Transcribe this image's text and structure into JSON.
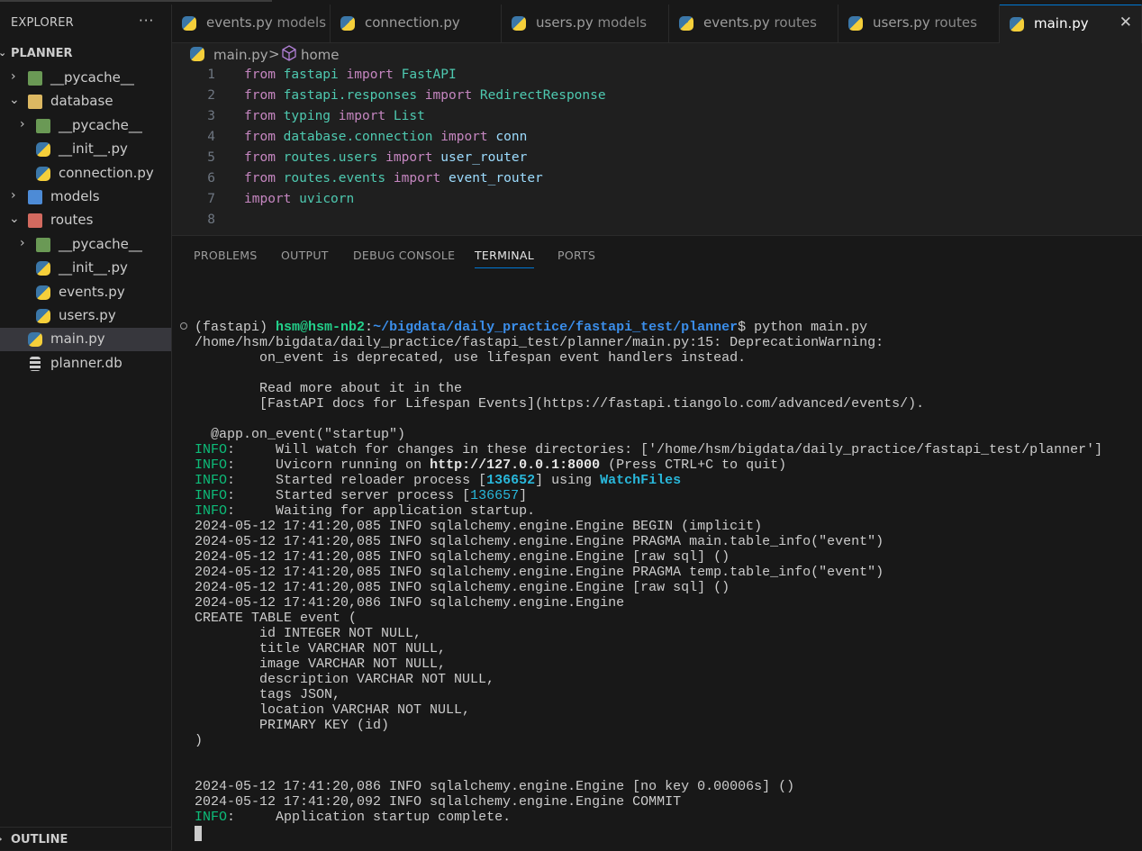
{
  "sidebar": {
    "title": "EXPLORER",
    "more": "···",
    "section": "PLANNER",
    "items": [
      {
        "label": "__pycache__",
        "icon": "pycache-folder-icon"
      },
      {
        "label": "database",
        "icon": "database-folder-icon"
      },
      {
        "label": "__pycache__",
        "icon": "pycache-folder-icon"
      },
      {
        "label": "__init__.py",
        "icon": "python-icon"
      },
      {
        "label": "connection.py",
        "icon": "python-icon"
      },
      {
        "label": "models",
        "icon": "models-folder-icon"
      },
      {
        "label": "routes",
        "icon": "routes-folder-icon"
      },
      {
        "label": "__pycache__",
        "icon": "pycache-folder-icon"
      },
      {
        "label": "__init__.py",
        "icon": "python-icon"
      },
      {
        "label": "events.py",
        "icon": "python-icon"
      },
      {
        "label": "users.py",
        "icon": "python-icon"
      },
      {
        "label": "main.py",
        "icon": "python-icon"
      },
      {
        "label": "planner.db",
        "icon": "database-icon"
      }
    ],
    "outline": "OUTLINE"
  },
  "tabs": [
    {
      "name": "events.py",
      "desc": "models"
    },
    {
      "name": "connection.py",
      "desc": ""
    },
    {
      "name": "users.py",
      "desc": "models"
    },
    {
      "name": "events.py",
      "desc": "routes"
    },
    {
      "name": "users.py",
      "desc": "routes"
    },
    {
      "name": "main.py",
      "desc": "",
      "active": true
    }
  ],
  "tab_close": "✕",
  "breadcrumb": {
    "file": "main.py",
    "sep": ">",
    "symbol": "home"
  },
  "editor": {
    "lines": [
      {
        "n": "1",
        "parts": [
          "from",
          "fastapi",
          "import",
          "FastAPI"
        ]
      },
      {
        "n": "2",
        "parts": [
          "from",
          "fastapi.responses",
          "import",
          "RedirectResponse"
        ]
      },
      {
        "n": "3",
        "parts": [
          "from",
          "typing",
          "import",
          "List"
        ]
      },
      {
        "n": "4",
        "parts": [
          "from",
          "database.connection",
          "import",
          "conn"
        ]
      },
      {
        "n": "5",
        "parts": [
          "from",
          "routes.users",
          "import",
          "user_router"
        ]
      },
      {
        "n": "6",
        "parts": [
          "from",
          "routes.events",
          "import",
          "event_router"
        ]
      },
      {
        "n": "7",
        "parts": [
          "import",
          "uvicorn",
          "",
          ""
        ]
      },
      {
        "n": "8",
        "parts": [
          "",
          "",
          "",
          ""
        ]
      }
    ]
  },
  "panel": {
    "tabs": [
      "PROBLEMS",
      "OUTPUT",
      "DEBUG CONSOLE",
      "TERMINAL",
      "PORTS"
    ],
    "active_tab": "TERMINAL"
  },
  "terminal": {
    "prompt_env": "(fastapi) ",
    "prompt_user": "hsm@hsm-nb2",
    "prompt_colon": ":",
    "prompt_path": "~/bigdata/daily_practice/fastapi_test/planner",
    "prompt_cmd": "$ python main.py",
    "lines": [
      "/home/hsm/bigdata/daily_practice/fastapi_test/planner/main.py:15: DeprecationWarning:",
      "        on_event is deprecated, use lifespan event handlers instead.",
      "",
      "        Read more about it in the",
      "        [FastAPI docs for Lifespan Events](https://fastapi.tiangolo.com/advanced/events/).",
      "",
      "  @app.on_event(\"startup\")"
    ],
    "info_label": "INFO",
    "info_colon": ":",
    "info1": "     Will watch for changes in these directories: ['/home/hsm/bigdata/daily_practice/fastapi_test/planner']",
    "info2_a": "     Uvicorn running on ",
    "info2_url": "http://127.0.0.1:8000",
    "info2_b": " (Press CTRL+C to quit)",
    "info3_a": "     Started reloader process [",
    "info3_pid": "136652",
    "info3_b": "] using ",
    "info3_tool": "WatchFiles",
    "info4_a": "     Started server process [",
    "info4_pid": "136657",
    "info4_b": "]",
    "info5": "     Waiting for application startup.",
    "log": [
      "2024-05-12 17:41:20,085 INFO sqlalchemy.engine.Engine BEGIN (implicit)",
      "2024-05-12 17:41:20,085 INFO sqlalchemy.engine.Engine PRAGMA main.table_info(\"event\")",
      "2024-05-12 17:41:20,085 INFO sqlalchemy.engine.Engine [raw sql] ()",
      "2024-05-12 17:41:20,085 INFO sqlalchemy.engine.Engine PRAGMA temp.table_info(\"event\")",
      "2024-05-12 17:41:20,085 INFO sqlalchemy.engine.Engine [raw sql] ()",
      "2024-05-12 17:41:20,086 INFO sqlalchemy.engine.Engine",
      "CREATE TABLE event (",
      "        id INTEGER NOT NULL,",
      "        title VARCHAR NOT NULL,",
      "        image VARCHAR NOT NULL,",
      "        description VARCHAR NOT NULL,",
      "        tags JSON,",
      "        location VARCHAR NOT NULL,",
      "        PRIMARY KEY (id)",
      ")",
      "",
      "",
      "2024-05-12 17:41:20,086 INFO sqlalchemy.engine.Engine [no key 0.00006s] ()",
      "2024-05-12 17:41:20,092 INFO sqlalchemy.engine.Engine COMMIT"
    ],
    "final": "     Application startup complete."
  },
  "colors": {
    "accent": "#0078d4",
    "terminal_info": "#0dbc79",
    "prompt_user": "#23d18b",
    "prompt_path": "#3b8eea"
  }
}
